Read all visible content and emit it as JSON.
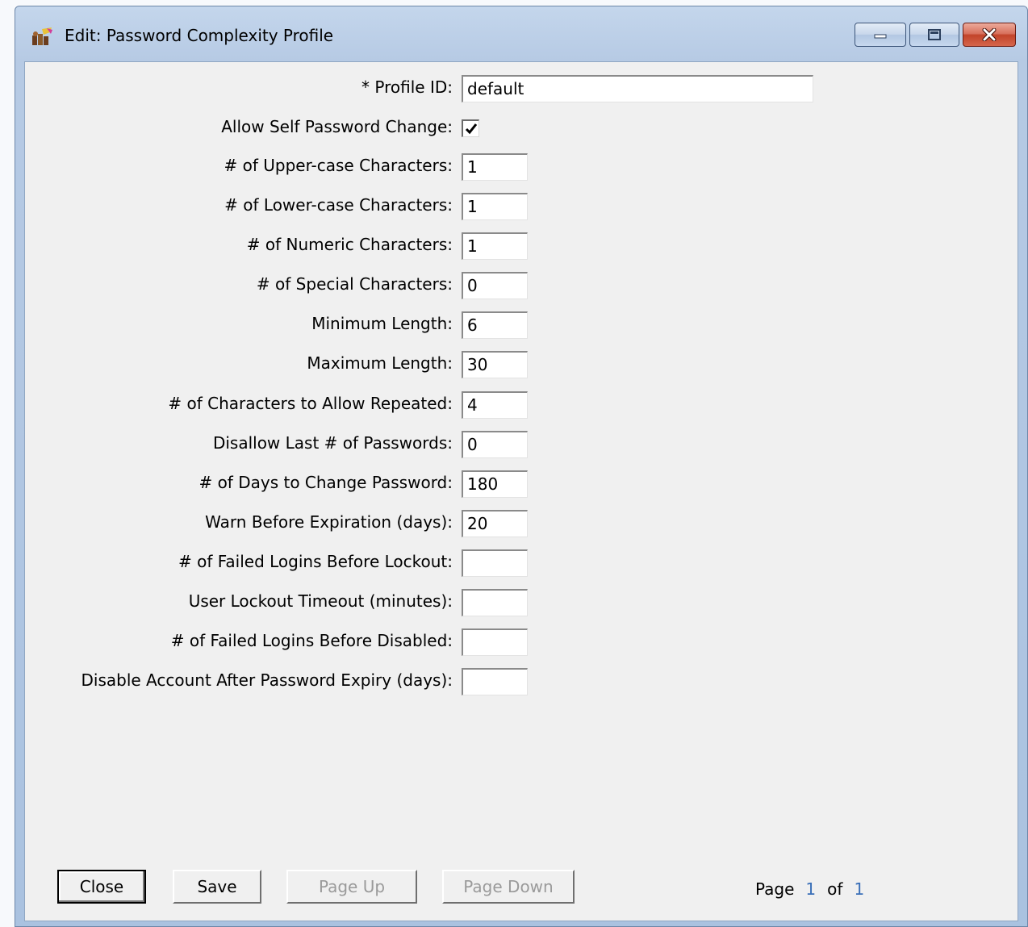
{
  "window": {
    "title": "Edit: Password Complexity Profile",
    "icon": "app-key-icon",
    "controls": [
      "minimize",
      "maximize",
      "close"
    ]
  },
  "form": {
    "profile_id": {
      "label": "* Profile ID:",
      "value": "default"
    },
    "allow_self_change": {
      "label": "Allow Self Password Change:",
      "checked": true
    },
    "upper": {
      "label": "# of Upper-case Characters:",
      "value": "1"
    },
    "lower": {
      "label": "# of Lower-case Characters:",
      "value": "1"
    },
    "numeric": {
      "label": "# of Numeric Characters:",
      "value": "1"
    },
    "special": {
      "label": "# of Special Characters:",
      "value": "0"
    },
    "min_length": {
      "label": "Minimum Length:",
      "value": "6"
    },
    "max_length": {
      "label": "Maximum Length:",
      "value": "30"
    },
    "repeated": {
      "label": "# of Characters to Allow Repeated:",
      "value": "4"
    },
    "disallow_last": {
      "label": "Disallow Last # of Passwords:",
      "value": "0"
    },
    "days_change": {
      "label": "# of Days to Change Password:",
      "value": "180"
    },
    "warn_before": {
      "label": "Warn Before Expiration (days):",
      "value": "20"
    },
    "failed_lockout": {
      "label": "# of Failed Logins Before Lockout:",
      "value": ""
    },
    "lockout_timeout": {
      "label": "User Lockout Timeout (minutes):",
      "value": ""
    },
    "failed_disabled": {
      "label": "# of Failed Logins Before Disabled:",
      "value": ""
    },
    "disable_after_expiry": {
      "label": "Disable Account After Password Expiry (days):",
      "value": ""
    }
  },
  "buttons": {
    "close": "Close",
    "save": "Save",
    "page_up": "Page Up",
    "page_down": "Page Down"
  },
  "pager": {
    "page_label": "Page",
    "current": "1",
    "of_label": "of",
    "total": "1"
  }
}
